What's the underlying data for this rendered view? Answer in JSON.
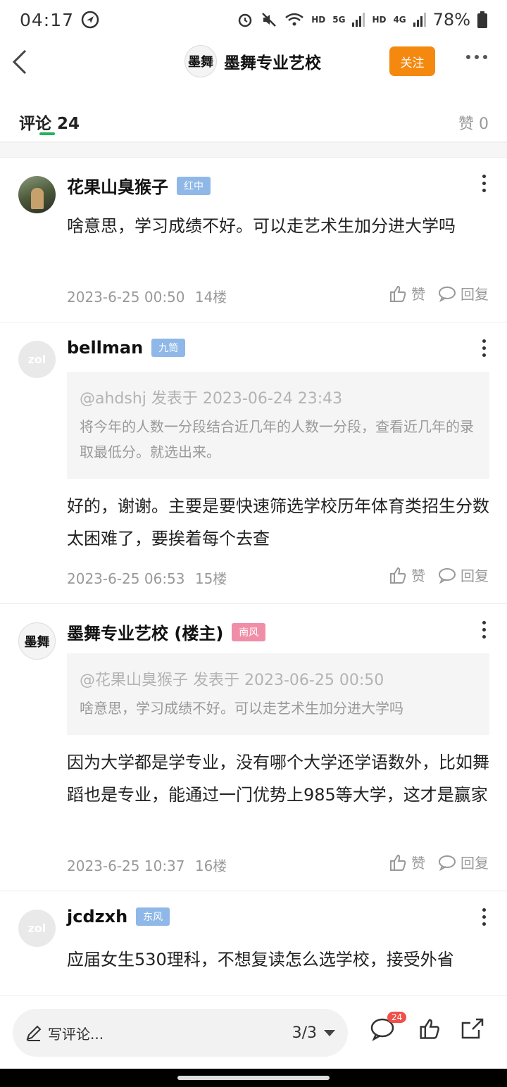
{
  "status_bar": {
    "time": "04:17",
    "net1": "HD",
    "net2": "5G",
    "net3": "HD",
    "net4": "4G",
    "battery": "78%"
  },
  "header": {
    "logo_text": "墨舞",
    "title": "墨舞专业艺校",
    "follow_label": "关注"
  },
  "tabs": {
    "comments_label": "评论 24",
    "likes_label": "赞 0"
  },
  "comments": [
    {
      "username": "花果山臭猴子",
      "badge": "红中",
      "text": "啥意思，学习成绩不好。可以走艺术生加分进大学吗",
      "time": "2023-6-25 00:50",
      "floor": "14楼",
      "like_label": "赞",
      "reply_label": "回复"
    },
    {
      "username": "bellman",
      "badge": "九筒",
      "avatar_text": "zol",
      "quote_head": "@ahdshj 发表于 2023-06-24 23:43",
      "quote_body": "将今年的人数一分段结合近几年的人数一分段，查看近几年的录取最低分。就选出来。",
      "text": "好的，谢谢。主要是要快速筛选学校历年体育类招生分数太困难了，要挨着每个去查",
      "time": "2023-6-25 06:53",
      "floor": "15楼",
      "like_label": "赞",
      "reply_label": "回复"
    },
    {
      "username": "墨舞专业艺校 (楼主)",
      "badge": "南风",
      "avatar_text": "墨舞",
      "quote_head": "@花果山臭猴子 发表于 2023-06-25 00:50",
      "quote_body": "啥意思，学习成绩不好。可以走艺术生加分进大学吗",
      "text": "因为大学都是学专业，没有哪个大学还学语数外，比如舞蹈也是专业，能通过一门优势上985等大学，这才是赢家",
      "time": "2023-6-25 10:37",
      "floor": "16楼",
      "like_label": "赞",
      "reply_label": "回复"
    },
    {
      "username": "jcdzxh",
      "badge": "东风",
      "avatar_text": "zol",
      "text": "应届女生530理科，不想复读怎么选学校，接受外省"
    }
  ],
  "bottom_bar": {
    "write_placeholder": "写评论...",
    "page_indicator": "3/3",
    "comment_count": "24"
  },
  "colors": {
    "accent_orange": "#f5890f",
    "tab_green": "#21b45a",
    "badge_blue": "#8fb8e8",
    "badge_pink": "#f08ea8",
    "count_red": "#f0504a"
  }
}
